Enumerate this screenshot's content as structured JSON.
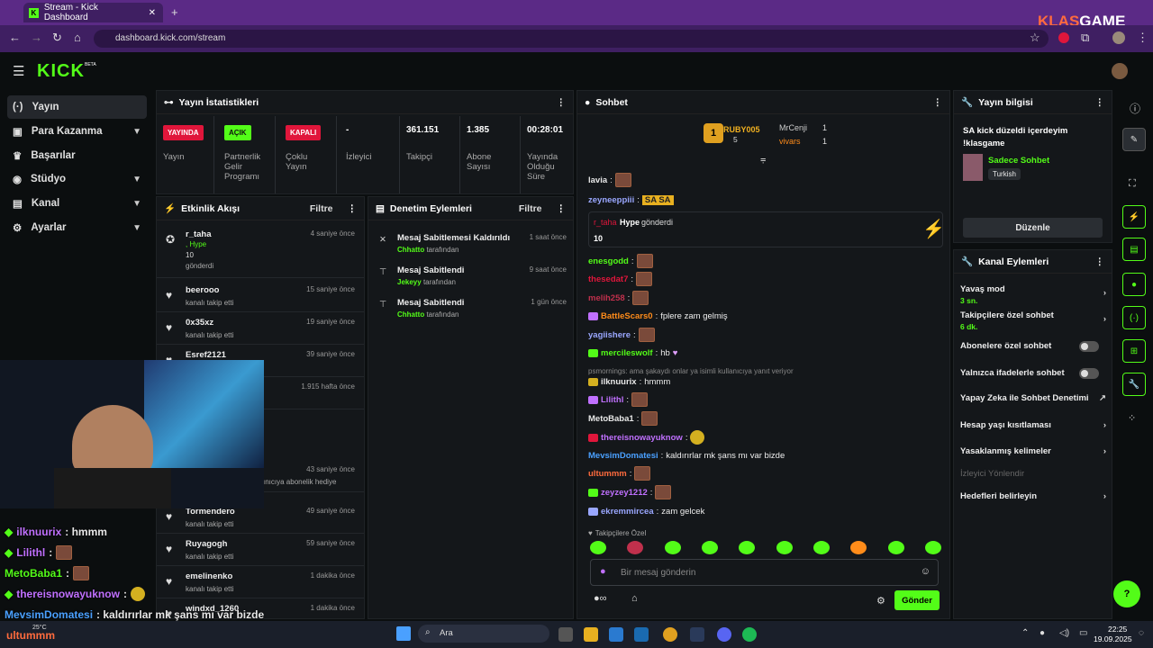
{
  "browser": {
    "tab_title": "Stream - Kick Dashboard",
    "url": "dashboard.kick.com/stream",
    "new_tab": "+",
    "close": "✕"
  },
  "watermark": {
    "a": "KLAS",
    "b": "GAME"
  },
  "logo": {
    "text": "KICK",
    "beta": "BETA"
  },
  "sidebar": {
    "items": [
      {
        "label": "Yayın",
        "icon": "(·)"
      },
      {
        "label": "Para Kazanma",
        "icon": "▣"
      },
      {
        "label": "Başarılar",
        "icon": "🏆"
      },
      {
        "label": "Stüdyo",
        "icon": "◉"
      },
      {
        "label": "Kanal",
        "icon": "▤"
      },
      {
        "label": "Ayarlar",
        "icon": "⚙"
      }
    ]
  },
  "stats": {
    "title": "Yayın İstatistikleri",
    "cols": [
      {
        "badge": "YAYINDA",
        "label": "Yayın",
        "color": "#e0163b"
      },
      {
        "badge": "AÇIK",
        "label": "Partnerlik Gelir Programı",
        "color": "#53fc18"
      },
      {
        "badge": "KAPALI",
        "label": "Çoklu Yayın",
        "color": "#e0163b"
      },
      {
        "value": "-",
        "label": "İzleyici"
      },
      {
        "value": "361.151",
        "label": "Takipçi"
      },
      {
        "value": "1.385",
        "label": "Abone Sayısı"
      },
      {
        "value": "00:28:01",
        "label": "Yayında Olduğu Süre"
      }
    ]
  },
  "activity": {
    "title": "Etkinlik Akışı",
    "filter": "Filtre",
    "rows": [
      {
        "user": "r_taha",
        "sub": "gönderdi",
        "time": "4 saniye önce"
      },
      {
        "user": "beerooo",
        "sub": "kanalı takip etti",
        "time": "15 saniye önce"
      },
      {
        "user": "0x35xz",
        "sub": "kanalı takip etti",
        "time": "19 saniye önce"
      },
      {
        "user": "Esref2121",
        "sub": "",
        "time": "39 saniye önce"
      },
      {
        "user": "",
        "sub": "",
        "time": "1.915 hafta önce"
      },
      {
        "user": "",
        "sub": "ınıcıya abonelik hediye",
        "time": "43 saniye önce"
      },
      {
        "user": "Tormendero",
        "sub": "kanalı takip etti",
        "time": "49 saniye önce"
      },
      {
        "user": "Ruyagogh",
        "sub": "kanalı takip etti",
        "time": "59 saniye önce"
      },
      {
        "user": "emelinenko",
        "sub": "kanalı takip etti",
        "time": "1 dakika önce"
      },
      {
        "user": "windxd_1260",
        "sub": "",
        "time": "1 dakika önce"
      }
    ],
    "hype_label": ", Hype",
    "hype_amount": "10"
  },
  "moderation": {
    "title": "Denetim Eylemleri",
    "filter": "Filtre",
    "rows": [
      {
        "title": "Mesaj Sabitlemesi Kaldırıldı",
        "by": "Chhatto",
        "suffix": "tarafından",
        "time": "1 saat önce"
      },
      {
        "title": "Mesaj Sabitlendi",
        "by": "Jekeyy",
        "suffix": "tarafından",
        "time": "9 saat önce"
      },
      {
        "title": "Mesaj Sabitlendi",
        "by": "Chhatto",
        "suffix": "tarafından",
        "time": "1 gün önce"
      }
    ]
  },
  "chat": {
    "title": "Sohbet",
    "top": {
      "rank": "1",
      "user1": "RUBY005",
      "count1": "5",
      "user2": "MrCenji",
      "count2": "1",
      "user3": "vivars",
      "count3": "1"
    },
    "hype": {
      "user": "r_taha",
      "text": "Hype",
      "rest": "gönderdi",
      "amount": "10"
    },
    "lines": [
      {
        "user": "lavia",
        "color": "#e8e8e8",
        "text": ""
      },
      {
        "user": "zeyneeppiii",
        "color": "#9aa7ff",
        "text": ""
      },
      {
        "user": "enesgodd",
        "color": "#53fc18",
        "text": ""
      },
      {
        "user": "thesedat7",
        "color": "#e0163b",
        "text": ""
      },
      {
        "user": "melih258",
        "color": "#c0304c",
        "text": ""
      },
      {
        "user": "BattleScars0",
        "color": "#ff8c1a",
        "text": "fplere zam gelmiş"
      },
      {
        "user": "yagiishere",
        "color": "#9aa7ff",
        "text": ""
      },
      {
        "user": "mercileswolf",
        "color": "#53fc18",
        "text": "hb"
      },
      {
        "user": "ilknuurix",
        "color": "#e8e8e8",
        "text": "hmmm"
      },
      {
        "user": "Lilithl",
        "color": "#c070ff",
        "text": ""
      },
      {
        "user": "MetoBaba1",
        "color": "#e8e8e8",
        "text": ""
      },
      {
        "user": "thereisnowayuknow",
        "color": "#c070ff",
        "text": ""
      },
      {
        "user": "MevsimDomatesi",
        "color": "#4aa0ff",
        "text": "kaldırırlar mk şans mı var bizde"
      },
      {
        "user": "ultummm",
        "color": "#ff6b3d",
        "text": ""
      },
      {
        "user": "zeyzey1212",
        "color": "#c070ff",
        "text": ""
      },
      {
        "user": "ekremmircea",
        "color": "#9aa7ff",
        "text": "zam gelcek"
      }
    ],
    "reply": "psmornings: ama şakaydı onlar ya isimli kullanıcıya yanıt veriyor",
    "followers_only": "Takipçilere Özel",
    "placeholder": "Bir mesaj gönderin",
    "send": "Gönder",
    "chip": "SA SA"
  },
  "info": {
    "title": "Yayın bilgisi",
    "stream_title": "SA kick düzeldi içerdeyim !klasgame",
    "category": "Sadece Sohbet",
    "lang": "Turkish",
    "edit": "Düzenle"
  },
  "channel": {
    "title": "Kanal Eylemleri",
    "items": [
      {
        "label": "Yavaş mod",
        "sub": "3 sn."
      },
      {
        "label": "Takipçilere özel sohbet",
        "sub": "6 dk."
      },
      {
        "label": "Abonelere özel sohbet",
        "sub": ""
      },
      {
        "label": "Yalnızca ifadelerle sohbet",
        "sub": ""
      },
      {
        "label": "Yapay Zeka ile Sohbet Denetimi",
        "sub": ""
      },
      {
        "label": "Hesap yaşı kısıtlaması",
        "sub": ""
      },
      {
        "label": "Yasaklanmış kelimeler",
        "sub": ""
      },
      {
        "label": "İzleyici Yönlendir",
        "sub": ""
      },
      {
        "label": "Hedefleri belirleyin",
        "sub": ""
      }
    ]
  },
  "overlay": {
    "lines": [
      {
        "user": "ilknuurix",
        "color": "#53fc18",
        "text": ": hmmm"
      },
      {
        "user": "Lilithl",
        "color": "#c070ff",
        "text": ":"
      },
      {
        "user": "MetoBaba1",
        "color": "#53fc18",
        "text": ":"
      },
      {
        "user": "thereisnowayuknow",
        "color": "#c070ff",
        "text": ":"
      },
      {
        "user": "MevsimDomatesi",
        "color": "#4aa0ff",
        "text": ": kaldırırlar mk şans mı var bizde"
      },
      {
        "user": "ultummm",
        "color": "#ff6b3d",
        "text": ":"
      }
    ]
  },
  "taskbar": {
    "search": "Ara",
    "time": "22:25",
    "date": "19.09.2025",
    "temp": "25°C"
  }
}
